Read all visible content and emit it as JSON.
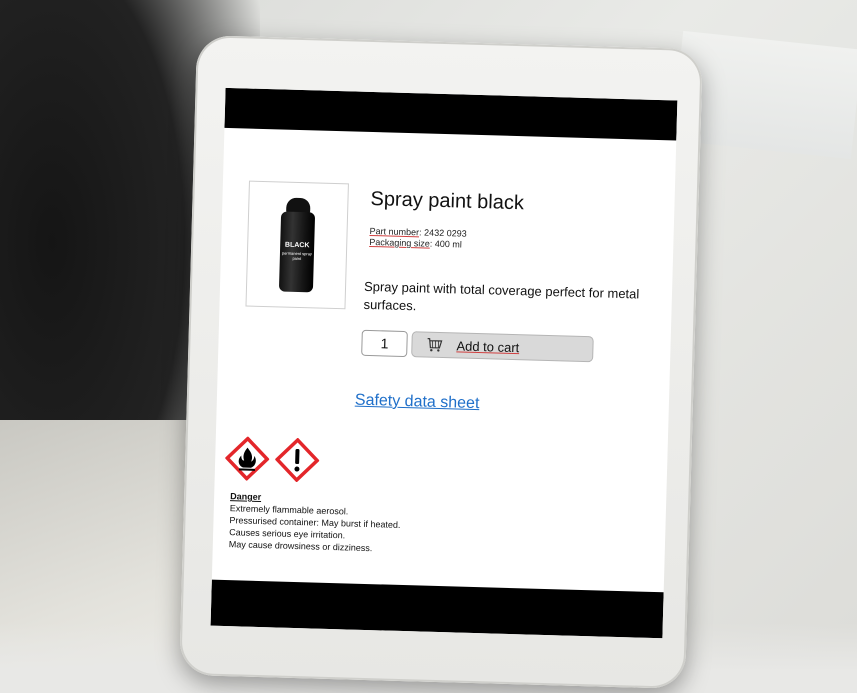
{
  "product": {
    "title": "Spray paint black",
    "part_number_label": "Part number",
    "part_number_value": ": 2432 0293",
    "packaging_size_label": "Packaging size",
    "packaging_size_value": ": 400 ml",
    "description": "Spray paint with total coverage perfect for metal surfaces.",
    "can_label": "BLACK",
    "can_fine_print": "permanent spray paint"
  },
  "cart": {
    "quantity": "1",
    "add_label": "Add to cart"
  },
  "links": {
    "safety_data_sheet": "Safety data sheet"
  },
  "hazard": {
    "icons": [
      "flammable-icon",
      "exclamation-icon"
    ],
    "signal_word": "Danger",
    "statements": [
      "Extremely flammable aerosol.",
      "Pressurised container: May burst if heated.",
      "Causes serious eye irritation.",
      "May cause drowsiness or dizziness."
    ]
  },
  "colors": {
    "link": "#1f6fc9",
    "hazard_red": "#e3262a",
    "button_bg": "#d9d9d9"
  }
}
